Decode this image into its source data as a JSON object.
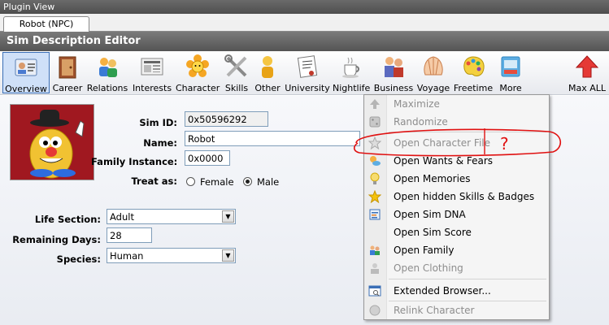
{
  "window": {
    "title": "Plugin View"
  },
  "tab": {
    "label": "Robot (NPC)"
  },
  "editor": {
    "title": "Sim Description Editor"
  },
  "toolbar": [
    {
      "label": "Overview",
      "icon": "id-card-icon",
      "active": true
    },
    {
      "label": "Career",
      "icon": "briefcase-icon"
    },
    {
      "label": "Relations",
      "icon": "people-icon"
    },
    {
      "label": "Interests",
      "icon": "newspaper-icon"
    },
    {
      "label": "Character",
      "icon": "flower-icon"
    },
    {
      "label": "Skills",
      "icon": "tools-icon"
    },
    {
      "label": "Other",
      "icon": "person-icon"
    },
    {
      "label": "University",
      "icon": "diploma-icon"
    },
    {
      "label": "Nightlife",
      "icon": "coffee-icon"
    },
    {
      "label": "Business",
      "icon": "business-people-icon"
    },
    {
      "label": "Voyage",
      "icon": "shell-icon"
    },
    {
      "label": "Freetime",
      "icon": "palette-icon"
    },
    {
      "label": "More",
      "icon": "more-icon"
    },
    {
      "label": "Max ALL",
      "icon": "up-arrow-icon"
    }
  ],
  "form": {
    "sim_id_label": "Sim ID:",
    "sim_id": "0x50596292",
    "name_label": "Name:",
    "name": "Robot",
    "family_label": "Family Instance:",
    "family": "0x0000",
    "treat_label": "Treat as:",
    "female": "Female",
    "male": "Male",
    "life_label": "Life Section:",
    "life": "Adult",
    "days_label": "Remaining Days:",
    "days": "28",
    "species_label": "Species:",
    "species": "Human"
  },
  "menu": [
    {
      "label": "Maximize",
      "disabled": true,
      "icon": "up-arrow-icon"
    },
    {
      "label": "Randomize",
      "disabled": true,
      "icon": "dice-icon"
    },
    {
      "label": "Open Character File",
      "disabled": true,
      "icon": "star-outline-icon"
    },
    {
      "label": "Open Wants & Fears",
      "icon": "sun-cloud-icon"
    },
    {
      "label": "Open Memories",
      "icon": "lightbulb-icon"
    },
    {
      "label": "Open hidden Skills & Badges",
      "icon": "star-icon"
    },
    {
      "label": "Open Sim DNA",
      "icon": "dna-icon"
    },
    {
      "label": "Open Sim Score",
      "icon": "none"
    },
    {
      "label": "Open Family",
      "icon": "family-icon"
    },
    {
      "label": "Open Clothing",
      "disabled": true,
      "icon": "clothing-icon"
    },
    {
      "label": "Extended Browser...",
      "icon": "browser-icon"
    },
    {
      "label": "Relink Character",
      "disabled": true,
      "icon": "relink-icon"
    }
  ],
  "annotation": {
    "mark": "?",
    "color": "#e01010"
  },
  "colors": {
    "toolbar_active": "#cfe0f8",
    "header": "#5f5f5f"
  }
}
